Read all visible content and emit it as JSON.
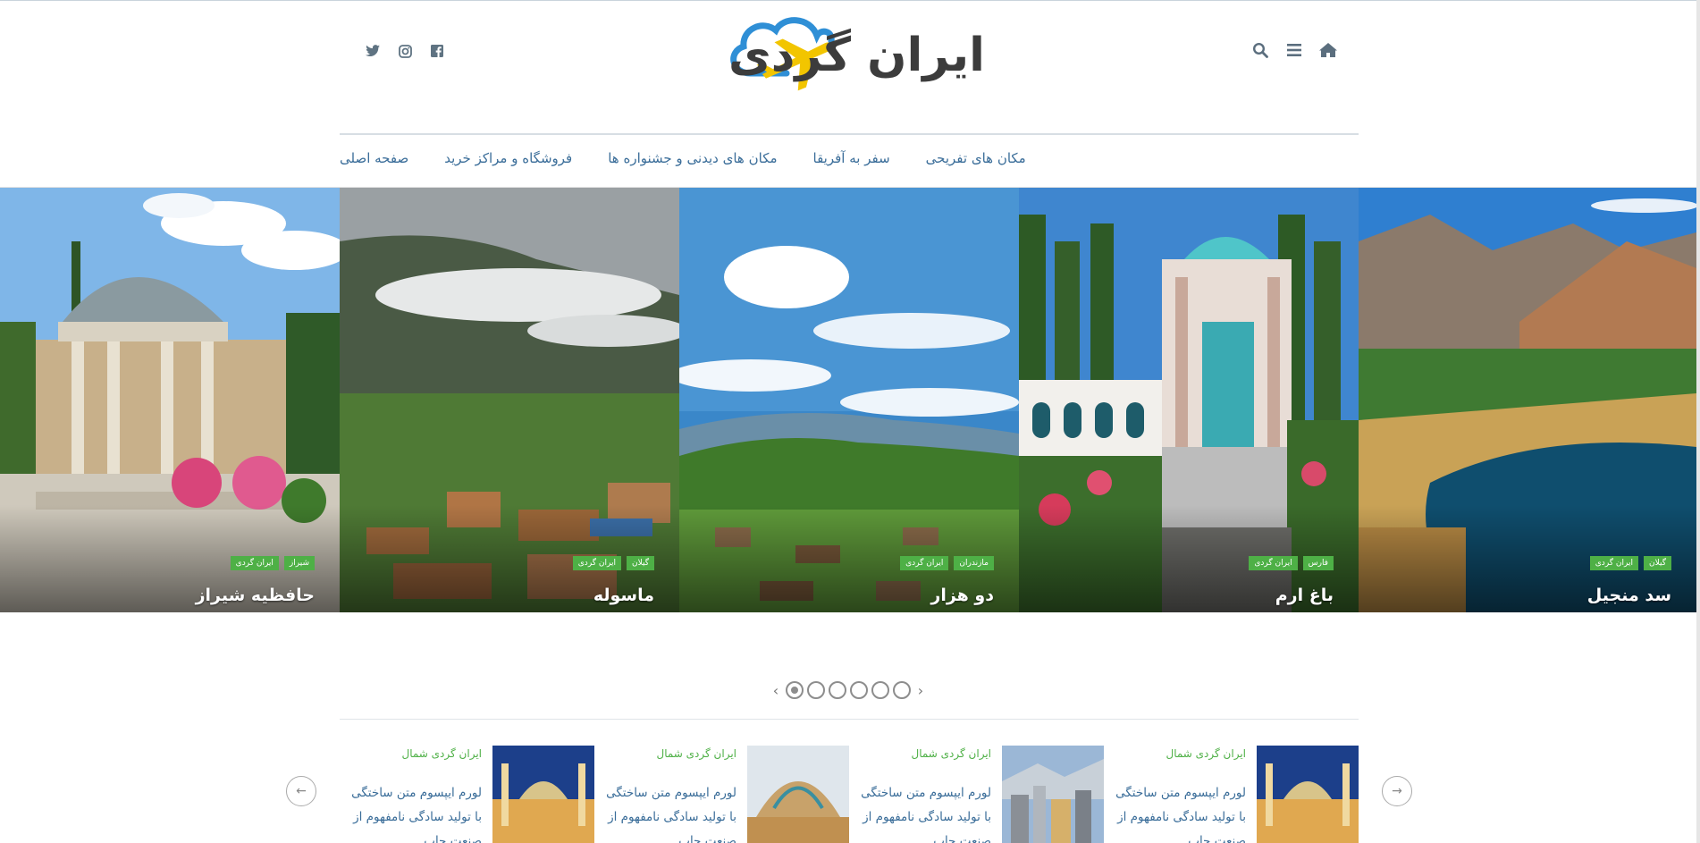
{
  "header": {
    "logo_text": "ایران گردی",
    "social": [
      {
        "icon": "twitter-icon",
        "glyph": "🐦"
      },
      {
        "icon": "instagram-icon",
        "glyph": "◎"
      },
      {
        "icon": "facebook-icon",
        "glyph": "f"
      }
    ],
    "tools": [
      {
        "icon": "search-icon"
      },
      {
        "icon": "menu-icon"
      },
      {
        "icon": "home-icon"
      }
    ]
  },
  "nav": {
    "items": [
      {
        "label": "صفحه اصلی"
      },
      {
        "label": "فروشگاه و مراکز خرید"
      },
      {
        "label": "مکان های دیدنی و جشنواره ها"
      },
      {
        "label": "سفر به آفریقا"
      },
      {
        "label": "مکان های تفریحی"
      }
    ]
  },
  "slider": {
    "slides": [
      {
        "title": "حافظیه شیراز",
        "tags": [
          "شیراز",
          "ایران گردی"
        ]
      },
      {
        "title": "ماسوله",
        "tags": [
          "گیلان",
          "ایران گردی"
        ]
      },
      {
        "title": "دو هزار",
        "tags": [
          "مازندران",
          "ایران گردی"
        ]
      },
      {
        "title": "باغ ارم",
        "tags": [
          "فارس",
          "ایران گردی"
        ]
      },
      {
        "title": "سد منجیل",
        "tags": [
          "گیلان",
          "ایران گردی"
        ]
      }
    ],
    "pages": 6,
    "active_page": 1
  },
  "cards": [
    {
      "category": "ایران گردی شمال",
      "excerpt": "لورم ایپسوم متن ساختگی با تولید سادگی نامفهوم از صنعت چاپ"
    },
    {
      "category": "ایران گردی شمال",
      "excerpt": "لورم ایپسوم متن ساختگی با تولید سادگی نامفهوم از صنعت چاپ"
    },
    {
      "category": "ایران گردی شمال",
      "excerpt": "لورم ایپسوم متن ساختگی با تولید سادگی نامفهوم از صنعت چاپ"
    },
    {
      "category": "ایران گردی شمال",
      "excerpt": "لورم ایپسوم متن ساختگی با تولید سادگی نامفهوم از صنعت چاپ"
    }
  ],
  "colors": {
    "nav_link": "#3a6d99",
    "tag_green": "#4eb046",
    "icon_gray": "#5f7382",
    "logo_cloud": "#2f8fd6",
    "logo_plane": "#f2c500"
  }
}
